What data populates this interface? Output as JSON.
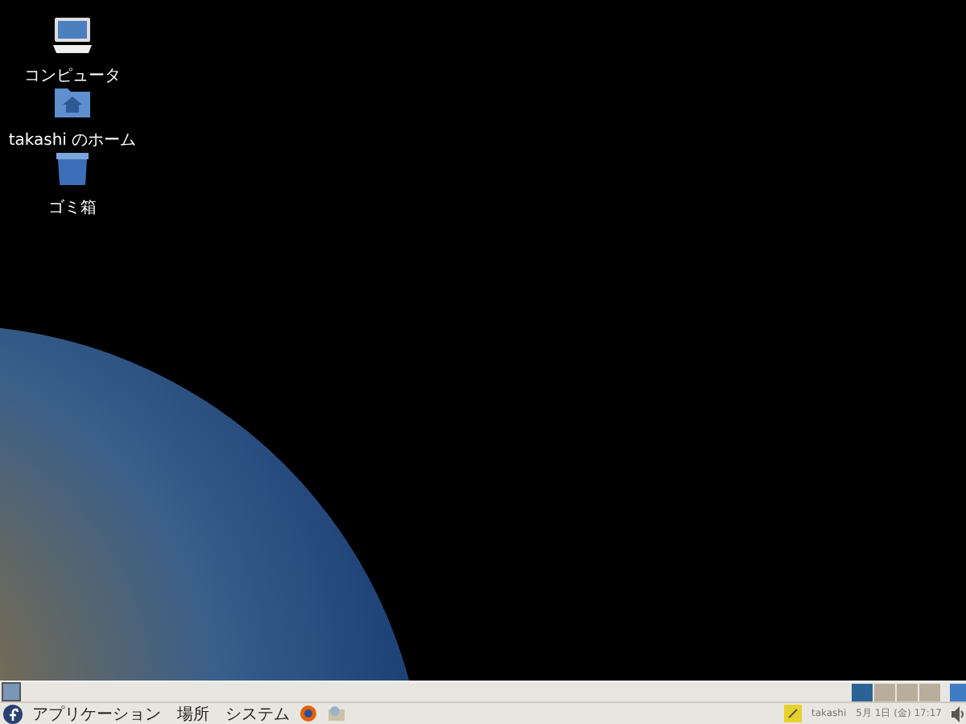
{
  "desktop_icons": [
    {
      "kind": "computer",
      "label": "コンピュータ"
    },
    {
      "kind": "home",
      "label": "takashi のホーム"
    },
    {
      "kind": "trash",
      "label": "ゴミ箱"
    }
  ],
  "workspaces": [
    {
      "selected": true
    },
    {
      "selected": false
    },
    {
      "selected": false
    },
    {
      "selected": false
    }
  ],
  "menu_panel": {
    "menus": [
      "アプリケーション",
      "場所",
      "システム"
    ],
    "user": "takashi",
    "clock": "5月 1日 (金) 17:17"
  }
}
